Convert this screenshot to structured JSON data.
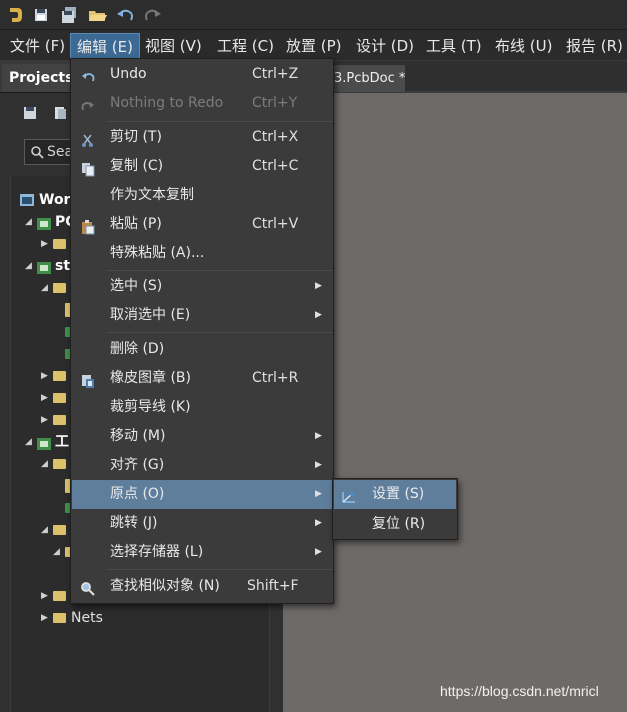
{
  "menubar": {
    "items": [
      {
        "label": "文件 (F)"
      },
      {
        "label": "编辑 (E)"
      },
      {
        "label": "视图 (V)"
      },
      {
        "label": "工程 (C)"
      },
      {
        "label": "放置 (P)"
      },
      {
        "label": "设计 (D)"
      },
      {
        "label": "工具 (T)"
      },
      {
        "label": "布线 (U)"
      },
      {
        "label": "报告 (R)"
      }
    ]
  },
  "projects_panel": {
    "tab_label": "Projects",
    "search_placeholder": "Sea",
    "tree": [
      {
        "label": "Worl"
      },
      {
        "label": "PC"
      },
      {
        "label": "str"
      },
      {
        "label": "工"
      },
      {
        "label": "Nets"
      }
    ]
  },
  "document_tab": {
    "label": "3.PcbDoc *"
  },
  "edit_menu": {
    "items": [
      {
        "label": "Undo",
        "shortcut": "Ctrl+Z",
        "icon": "undo-icon"
      },
      {
        "label": "Nothing to Redo",
        "shortcut": "Ctrl+Y",
        "icon": "redo-icon",
        "disabled": true
      },
      {
        "label": "剪切 (T)",
        "shortcut": "Ctrl+X",
        "icon": "scissors-icon"
      },
      {
        "label": "复制 (C)",
        "shortcut": "Ctrl+C",
        "icon": "copy-icon"
      },
      {
        "label": "作为文本复制",
        "shortcut": ""
      },
      {
        "label": "粘贴 (P)",
        "shortcut": "Ctrl+V",
        "icon": "paste-icon"
      },
      {
        "label": "特殊粘贴 (A)...",
        "shortcut": ""
      },
      {
        "label": "选中 (S)",
        "submenu": true
      },
      {
        "label": "取消选中 (E)",
        "submenu": true
      },
      {
        "label": "删除 (D)",
        "shortcut": ""
      },
      {
        "label": "橡皮图章 (B)",
        "shortcut": "Ctrl+R",
        "icon": "rubber-stamp-icon"
      },
      {
        "label": "裁剪导线 (K)",
        "shortcut": ""
      },
      {
        "label": "移动 (M)",
        "submenu": true
      },
      {
        "label": "对齐 (G)",
        "submenu": true
      },
      {
        "label": "原点 (O)",
        "submenu": true,
        "highlighted": true
      },
      {
        "label": "跳转 (J)",
        "submenu": true
      },
      {
        "label": "选择存储器 (L)",
        "submenu": true
      },
      {
        "label": "查找相似对象 (N)",
        "shortcut": "Shift+F",
        "icon": "find-similar-icon"
      }
    ]
  },
  "origin_submenu": {
    "items": [
      {
        "label": "设置 (S)",
        "icon": "set-origin-icon",
        "highlighted": true
      },
      {
        "label": "复位 (R)"
      }
    ]
  },
  "watermark": "https://blog.csdn.net/mricl",
  "colors": {
    "menu_bg": "#3b3b3b",
    "highlight": "#5f7e9c",
    "active_menu": "#3d6a94",
    "canvas": "#6e6a68"
  }
}
